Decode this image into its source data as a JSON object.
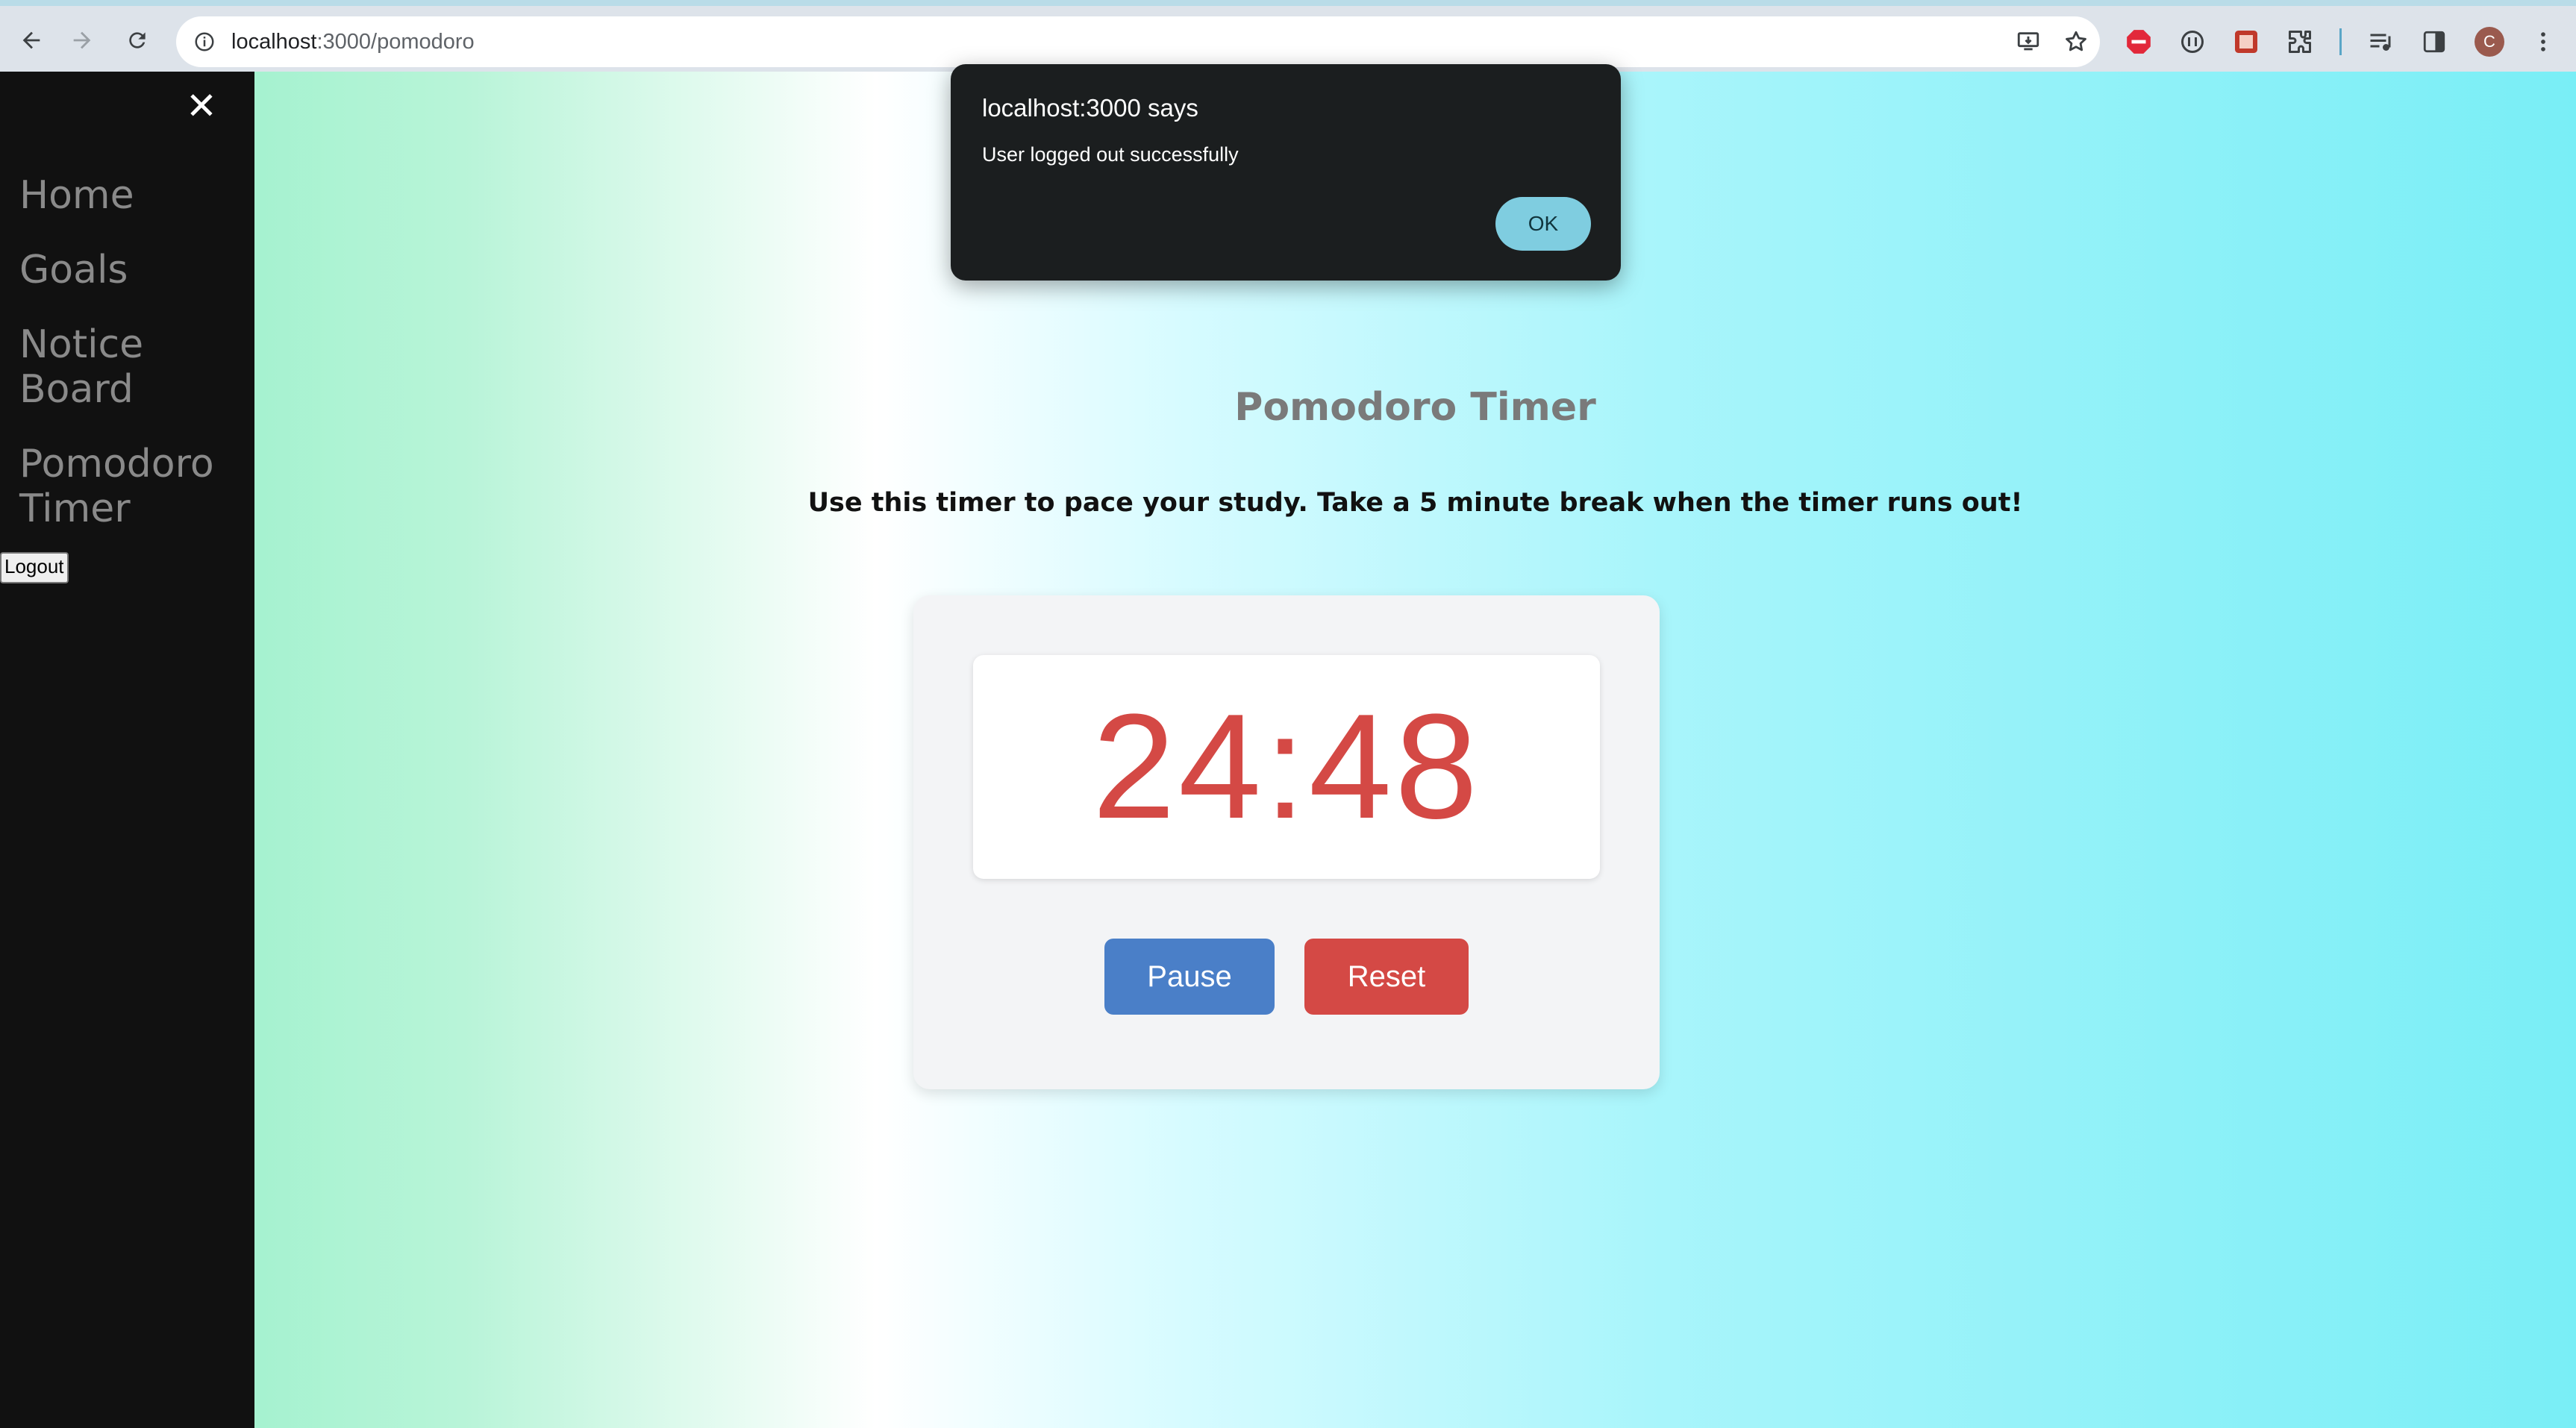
{
  "browser": {
    "url_host": "localhost",
    "url_rest": ":3000/pomodoro",
    "avatar_initial": "C",
    "icons": [
      "back-arrow-icon",
      "forward-arrow-icon",
      "reload-icon",
      "site-info-icon",
      "install-app-icon",
      "bookmark-star-icon",
      "adblock-extension-icon",
      "extension-icon",
      "extension-icon",
      "extensions-puzzle-icon",
      "media-control-icon",
      "side-panel-icon",
      "menu-kebab-icon"
    ]
  },
  "sidebar": {
    "close_symbol": "✕",
    "items": [
      {
        "label": "Home"
      },
      {
        "label": "Goals"
      },
      {
        "label": "Notice Board"
      },
      {
        "label": "Pomodoro Timer"
      }
    ],
    "logout_label": "Logout"
  },
  "main": {
    "title": "Pomodoro Timer",
    "subtitle": "Use this timer to pace your study. Take a 5 minute break when the timer runs out!",
    "timer": "24:48",
    "pause_label": "Pause",
    "reset_label": "Reset"
  },
  "dialog": {
    "title": "localhost:3000 says",
    "message": "User logged out successfully",
    "ok_label": "OK"
  },
  "colors": {
    "timer_red": "#d44945",
    "pause_blue": "#4a7fc8",
    "sidebar_bg": "#111111",
    "dialog_bg": "#1b1e1f",
    "ok_button": "#7fcde0"
  }
}
